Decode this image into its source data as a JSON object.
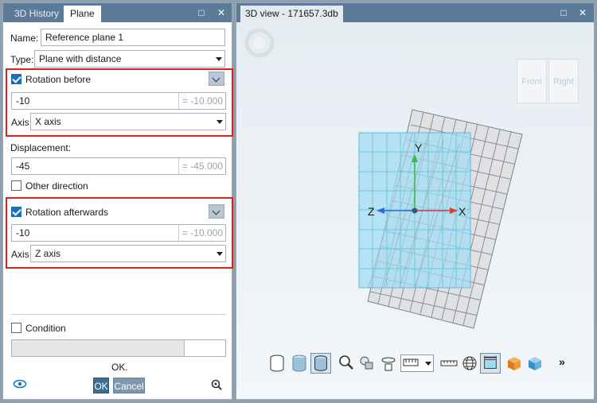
{
  "left_panel": {
    "tabs": [
      {
        "label": "3D History"
      },
      {
        "label": "Plane"
      }
    ],
    "window_controls": {
      "maximize": "□",
      "close": "✕"
    },
    "name": {
      "label": "Name:",
      "value": "Reference plane 1"
    },
    "type": {
      "label": "Type:",
      "value": "Plane with distance"
    },
    "rotation_before": {
      "label": "Rotation before",
      "checked": true,
      "value": "-10",
      "computed": "= -10.000",
      "axis_label": "Axis",
      "axis_value": "X axis"
    },
    "displacement": {
      "label": "Displacement:",
      "value": "-45",
      "computed": "= -45.000"
    },
    "other_direction": {
      "label": "Other direction",
      "checked": false
    },
    "rotation_after": {
      "label": "Rotation afterwards",
      "checked": true,
      "value": "-10",
      "computed": "= -10.000",
      "axis_label": "Axis",
      "axis_value": "Z axis"
    },
    "condition": {
      "label": "Condition",
      "checked": false
    },
    "status_text": "OK.",
    "ok_label": "OK",
    "cancel_label": "Cancel",
    "icons": {
      "visibility": "eye-icon",
      "zoom": "zoom-icon"
    }
  },
  "view3d": {
    "tab_title": "3D view - 171657.3db",
    "window_controls": {
      "maximize": "□",
      "close": "✕"
    },
    "viewcube": {
      "front": "Front",
      "right": "Right"
    },
    "axes": {
      "x": "X",
      "y": "Y",
      "z": "Z"
    },
    "colors": {
      "x_axis": "#e23b3b",
      "y_axis": "#2fbf4a",
      "z_axis": "#2f6fd8",
      "plane": "#9fdcf3",
      "grey_plane": "#e2e2e2"
    },
    "toolbar_more": "»"
  }
}
